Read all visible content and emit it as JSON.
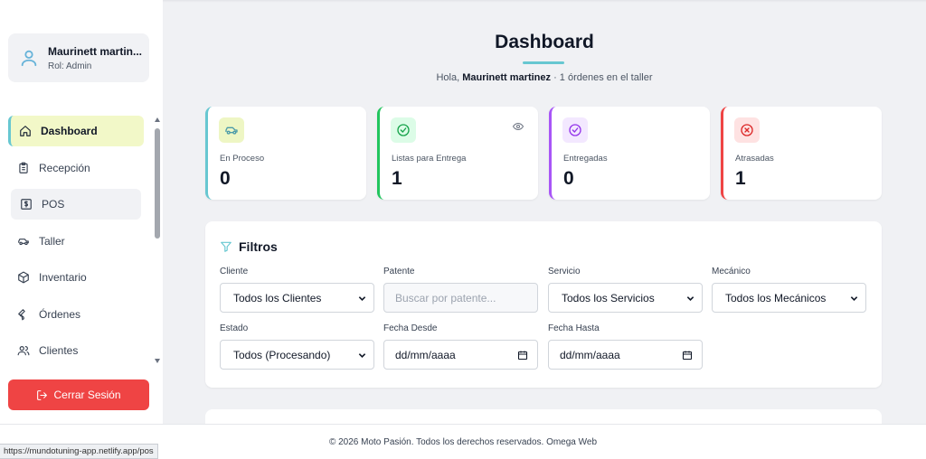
{
  "user": {
    "name": "Maurinett martin...",
    "role": "Rol: Admin"
  },
  "nav": [
    {
      "label": "Dashboard",
      "icon": "home-icon"
    },
    {
      "label": "Recepción",
      "icon": "clipboard-icon"
    },
    {
      "label": "POS",
      "icon": "dollar-icon"
    },
    {
      "label": "Taller",
      "icon": "car-icon"
    },
    {
      "label": "Inventario",
      "icon": "box-icon"
    },
    {
      "label": "Órdenes",
      "icon": "wrench-icon"
    },
    {
      "label": "Clientes",
      "icon": "users-icon"
    }
  ],
  "logout_label": "Cerrar Sesión",
  "header": {
    "title": "Dashboard",
    "greeting_prefix": "Hola, ",
    "greeting_name": "Maurinett martinez",
    "greeting_suffix": " · 1 órdenes en el taller"
  },
  "cards": [
    {
      "label": "En Proceso",
      "value": "0",
      "accent": "#67c7d1",
      "icon_bg": "#eef6c4",
      "icon": "car-icon"
    },
    {
      "label": "Listas para Entrega",
      "value": "1",
      "accent": "#22c55e",
      "icon_bg": "#dcfce7",
      "icon": "check-circle-icon"
    },
    {
      "label": "Entregadas",
      "value": "0",
      "accent": "#a855f7",
      "icon_bg": "#f3e8ff",
      "icon": "check-circle-icon"
    },
    {
      "label": "Atrasadas",
      "value": "1",
      "accent": "#ef4444",
      "icon_bg": "#fee2e2",
      "icon": "x-circle-icon"
    }
  ],
  "filters": {
    "title": "Filtros",
    "cliente_label": "Cliente",
    "cliente_value": "Todos los Clientes",
    "patente_label": "Patente",
    "patente_placeholder": "Buscar por patente...",
    "servicio_label": "Servicio",
    "servicio_value": "Todos los Servicios",
    "mecanico_label": "Mecánico",
    "mecanico_value": "Todos los Mecánicos",
    "estado_label": "Estado",
    "estado_value": "Todos (Procesando)",
    "desde_label": "Fecha Desde",
    "desde_value": "dd/mm/aaaa",
    "hasta_label": "Fecha Hasta",
    "hasta_value": "dd/mm/aaaa"
  },
  "footer_text": "© 2026 Moto Pasión. Todos los derechos reservados. Omega Web",
  "status_url": "https://mundotuning-app.netlify.app/pos",
  "colors": {
    "accent": "#67c7d1",
    "danger": "#ef4444"
  }
}
